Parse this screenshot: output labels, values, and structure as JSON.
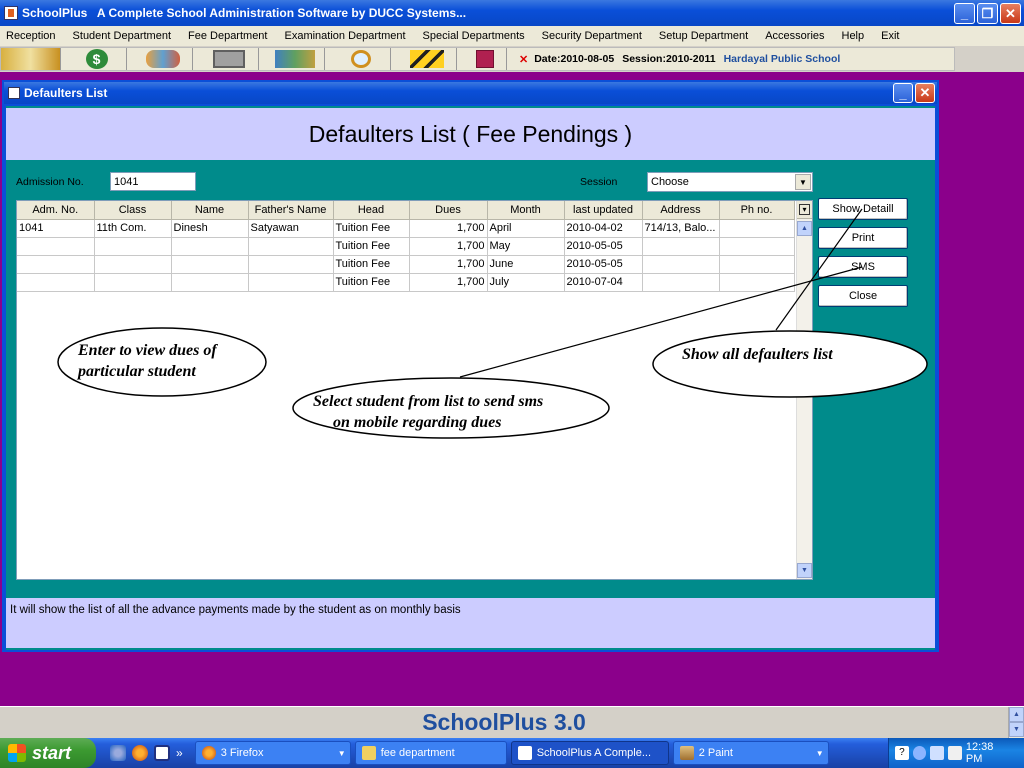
{
  "app": {
    "title": "SchoolPlus   A Complete School Administration Software by DUCC Systems...",
    "minimize": "_",
    "restore": "❐",
    "close": "✕"
  },
  "menu": [
    "Reception",
    "Student Department",
    "Fee Department",
    "Examination Department",
    "Special  Departments",
    "Security Department",
    "Setup Department",
    "Accessories",
    "Help",
    "Exit"
  ],
  "toolbar": {
    "icons": [
      "books-icon",
      "money-icon",
      "people-icon",
      "safe-icon",
      "globe-icon",
      "search-glass-icon",
      "building-icon",
      "calendar-icon"
    ],
    "close_mark": "✕",
    "date": "Date:2010-08-05",
    "session": "Session:2010-2011",
    "school": "Hardayal Public School"
  },
  "window": {
    "title": "Defaulters List",
    "heading": "Defaulters List ( Fee Pendings )",
    "admission_label": "Admission No.",
    "admission_value": "1041",
    "session_label": "Session",
    "session_value": "Choose",
    "status_text": "It will show the list of all the advance payments made by the student as on monthly basis"
  },
  "table": {
    "columns": [
      "Adm. No.",
      "Class",
      "Name",
      "Father's Name",
      "Head",
      "Dues",
      "Month",
      "last updated",
      "Address",
      "Ph no."
    ],
    "rows": [
      [
        "1041",
        "11th Com.",
        "Dinesh",
        "Satyawan",
        "Tuition Fee",
        "1,700",
        "April",
        "2010-04-02",
        "714/13, Balo...",
        ""
      ],
      [
        "",
        "",
        "",
        "",
        "Tuition Fee",
        "1,700",
        "May",
        "2010-05-05",
        "",
        ""
      ],
      [
        "",
        "",
        "",
        "",
        "Tuition Fee",
        "1,700",
        "June",
        "2010-05-05",
        "",
        ""
      ],
      [
        "",
        "",
        "",
        "",
        "Tuition Fee",
        "1,700",
        "July",
        "2010-07-04",
        "",
        ""
      ]
    ]
  },
  "buttons": {
    "show_detail": "Show Detaill",
    "print": "Print",
    "sms": "SMS",
    "close": "Close"
  },
  "annotations": {
    "enter": [
      "Enter to view dues of",
      "particular student"
    ],
    "select": [
      "Select student from list to send sms",
      "on mobile regarding dues"
    ],
    "show_all": [
      "Show all defaulters list"
    ]
  },
  "footer": {
    "product": "SchoolPlus 3.0"
  },
  "taskbar": {
    "start": "start",
    "more": "»",
    "tasks": [
      "3 Firefox",
      "fee department",
      "SchoolPlus   A Comple...",
      "2 Paint"
    ],
    "clock": "12:38 PM"
  },
  "colors": {
    "desktop": "#8b008b",
    "panel": "#008b8b",
    "band": "#ccccff",
    "xp_blue": "#0a4fd8",
    "accent_text": "#1f4f9f"
  }
}
